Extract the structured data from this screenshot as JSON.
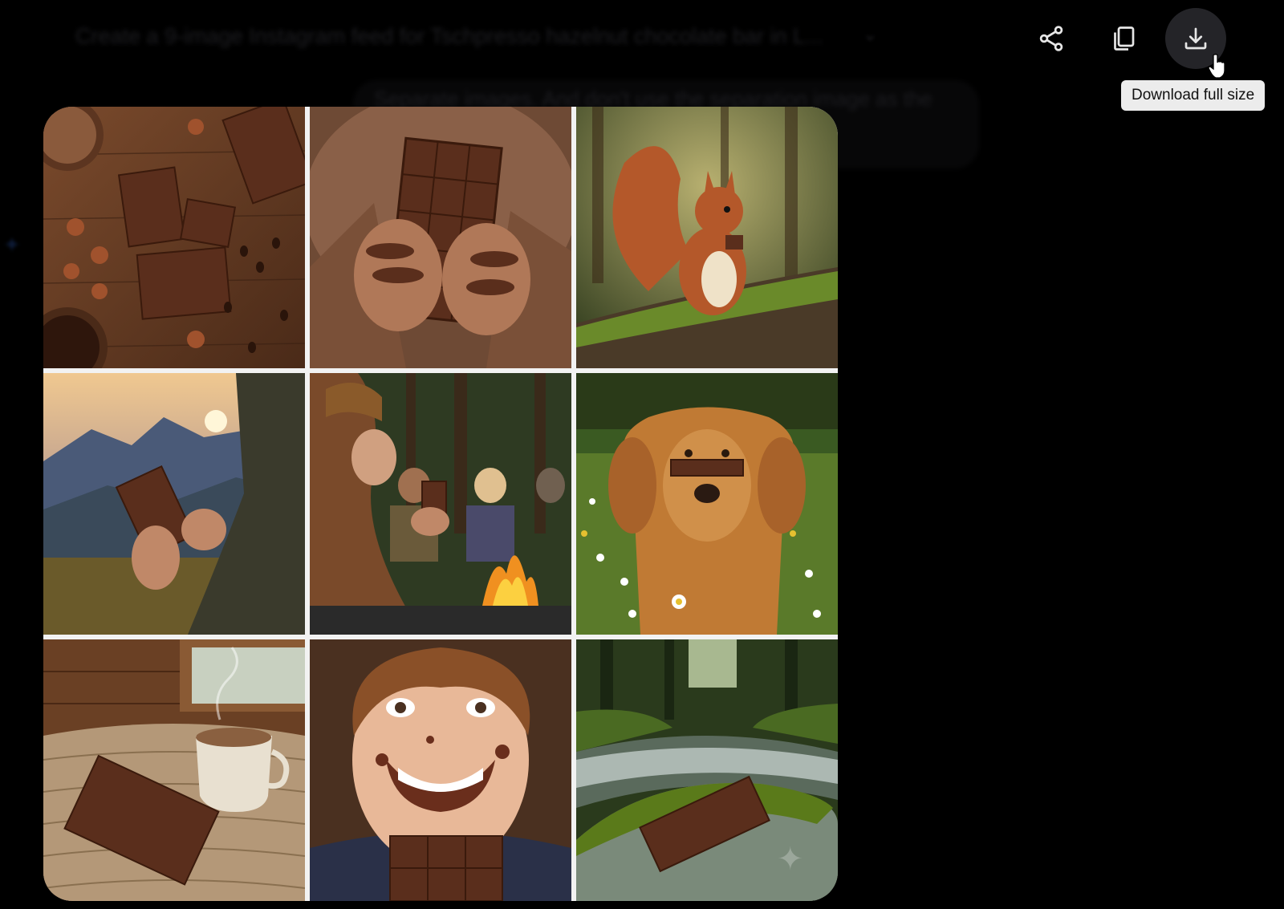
{
  "conversation": {
    "prompt_title": "Create a 9-image Instagram feed for Tschpresso hazelnut chocolate bar in L...",
    "prompt_followup": "Separate images. And don't use the separation image as the"
  },
  "toolbar": {
    "share_icon": "share-icon",
    "copy_icon": "copy-icon",
    "download_icon": "download-icon",
    "download_tooltip": "Download full size"
  },
  "image_grid": {
    "tiles": [
      {
        "subject": "chocolate-bars-on-wood-with-hazelnuts-and-coffee-beans"
      },
      {
        "subject": "hands-holding-chocolate-bar-in-sweater"
      },
      {
        "subject": "red-squirrel-with-chocolate-on-mossy-log"
      },
      {
        "subject": "hiker-holding-chocolate-at-mountain-sunset"
      },
      {
        "subject": "woman-with-chocolate-at-campfire"
      },
      {
        "subject": "golden-retriever-with-chocolate-in-meadow"
      },
      {
        "subject": "chocolate-bar-and-coffee-mug-on-knit-blanket"
      },
      {
        "subject": "smiling-boy-with-chocolate-face"
      },
      {
        "subject": "chocolate-bar-on-mossy-rock-by-stream"
      }
    ]
  },
  "colors": {
    "background": "#000000",
    "tooltip_bg": "#ececec",
    "icon": "#e6e6e6",
    "chocolate": "#5a2e1c"
  }
}
